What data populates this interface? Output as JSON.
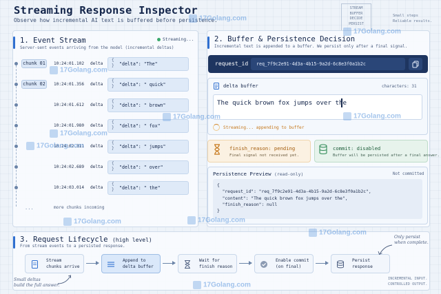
{
  "header": {
    "title": "Streaming Response Inspector",
    "subtitle": "Observe how incremental AI text is buffered before persistence.",
    "note_box": [
      "STREAM",
      "BUFFER",
      "DECIDE",
      "PERSIST"
    ],
    "note_right": [
      "Small steps",
      "Reliable results."
    ]
  },
  "event_stream": {
    "title": "1. Event Stream",
    "subtitle": "Server-sent events arriving from the model (incremental deltas)",
    "status": "Streaming...",
    "events": [
      {
        "chunk": "chunk 01",
        "time": "10:24:01.102",
        "kind": "delta",
        "key": "\"delta\"",
        "value": "\"The\""
      },
      {
        "chunk": "chunk 02",
        "time": "10:24:01.356",
        "kind": "delta",
        "key": "\"delta\"",
        "value": "\" quick\""
      },
      {
        "chunk": "",
        "time": "10:24:01.612",
        "kind": "delta",
        "key": "\"delta\"",
        "value": "\" brown\""
      },
      {
        "chunk": "",
        "time": "10:24:01.980",
        "kind": "delta",
        "key": "\"delta\"",
        "value": "\" fox\""
      },
      {
        "chunk": "",
        "time": "10:24:02.311",
        "kind": "delta",
        "key": "\"delta\"",
        "value": "\" jumps\""
      },
      {
        "chunk": "",
        "time": "10:24:02.689",
        "kind": "delta",
        "key": "\"delta\"",
        "value": "\" over\""
      },
      {
        "chunk": "",
        "time": "10:24:03.014",
        "kind": "delta",
        "key": "\"delta\"",
        "value": "\" the\""
      }
    ],
    "more_dots": "...",
    "more_text": "more chunks incoming"
  },
  "buffer": {
    "title": "2. Buffer & Persistence Decision",
    "subtitle": "Incremental text is appended to a buffer. We persist only after a final signal.",
    "request_label": "request_id",
    "request_value": "req_7f9c2e91-4d3a-4b15-9a2d-6c8e3f0a1b2c",
    "buffer_title": "delta buffer",
    "chars": "characters: 31",
    "buffer_text": "The quick brown fox jumps over the",
    "streaming_note": "Streaming... appending to buffer",
    "finish_title": "finish_reason: pending",
    "finish_note": "Final signal not received yet.",
    "commit_title": "commit: disabled",
    "commit_note": "Buffer will be persisted after a final answer.",
    "preview_title": "Persistence Preview",
    "preview_readonly": "(read-only)",
    "preview_tag": "Not committed",
    "preview_code": "{\n  \"request_id\": \"req_7f9c2e91-4d3a-4b15-9a2d-6c8e3f0a1b2c\",\n  \"content\": \"The quick brown fox jumps over the\",\n  \"finish_reason\": null\n}"
  },
  "lifecycle": {
    "title": "3. Request Lifecycle",
    "title_suffix": "(high level)",
    "subtitle": "From stream events to a persisted response.",
    "steps": [
      {
        "l1": "Stream",
        "l2": "chunks arrive"
      },
      {
        "l1": "Append to",
        "l2": "delta buffer"
      },
      {
        "l1": "Wait for",
        "l2": "finish reason"
      },
      {
        "l1": "Enable commit",
        "l2": "(on final)"
      },
      {
        "l1": "Persist",
        "l2": "response"
      }
    ],
    "hand_left": [
      "Small deltas",
      "build the full answer."
    ],
    "hand_right": [
      "Only persist",
      "when complete."
    ],
    "footer": [
      "INCREMENTAL INPUT.",
      "CONTROLLED OUTPUT."
    ]
  },
  "watermark": "17Golang.com",
  "colors": {
    "accent": "#2f6fd0",
    "dark_bar": "#1e3560",
    "pending": "#a35b0b",
    "commit": "#1d5e3a"
  }
}
